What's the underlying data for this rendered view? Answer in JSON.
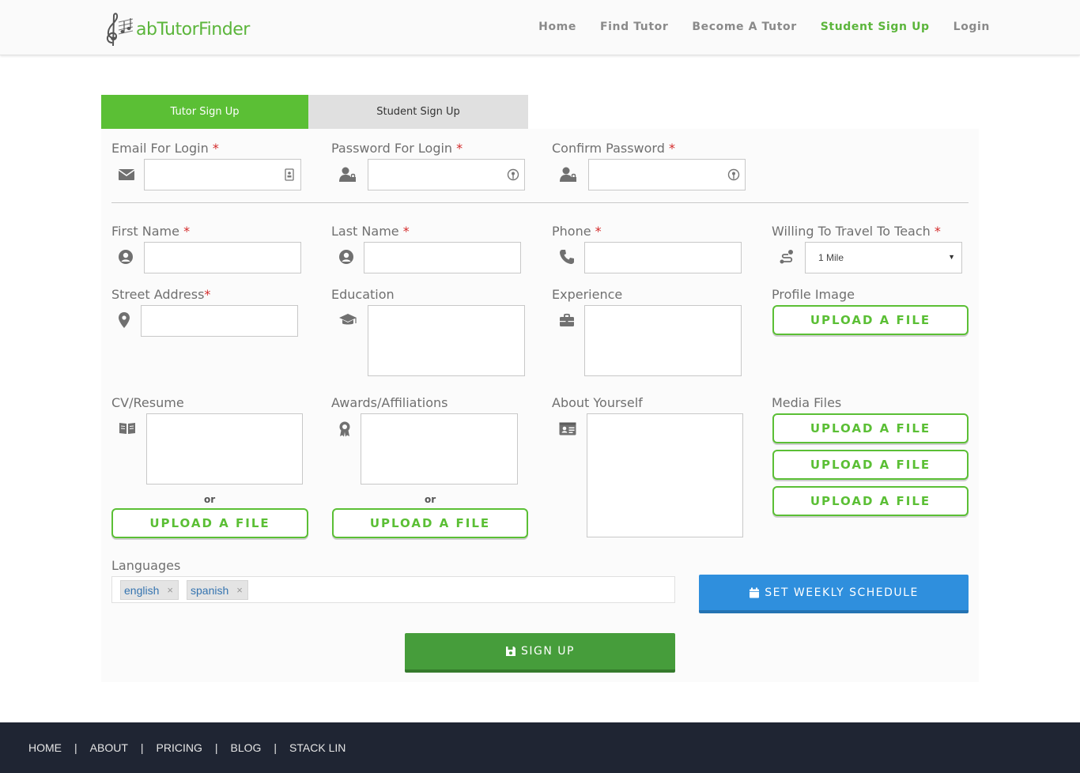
{
  "header": {
    "logo_text": "abTutorFinder",
    "nav": [
      "Home",
      "Find Tutor",
      "Become A Tutor",
      "Student Sign Up",
      "Login"
    ],
    "active_nav": "Student Sign Up"
  },
  "tabs": {
    "tutor": "Tutor Sign Up",
    "student": "Student Sign Up"
  },
  "form": {
    "email_label": "Email For Login",
    "password_label": "Password For Login",
    "confirm_label": "Confirm Password",
    "first_name_label": "First Name",
    "last_name_label": "Last Name",
    "phone_label": "Phone",
    "travel_label": "Willing To Travel To Teach",
    "travel_value": "1 Mile",
    "street_label": "Street Address",
    "education_label": "Education",
    "experience_label": "Experience",
    "profile_image_label": "Profile Image",
    "cv_label": "CV/Resume",
    "awards_label": "Awards/Affiliations",
    "about_label": "About Yourself",
    "media_label": "Media Files",
    "or_text": "or",
    "upload_label": "UPLOAD A FILE",
    "required_mark": "*",
    "languages_label": "Languages",
    "languages": [
      "english",
      "spanish"
    ],
    "tag_remove": "×",
    "schedule_button": "SET WEEKLY SCHEDULE",
    "signup_button": "SIGN UP"
  },
  "footer": {
    "links": [
      "HOME",
      "ABOUT",
      "PRICING",
      "BLOG",
      "STACK LIN"
    ],
    "separator": "|"
  },
  "colors": {
    "brand_green": "#5bbf35",
    "signup_green": "#469d3b",
    "schedule_blue": "#2f8fdd",
    "required_red": "#d42b2b",
    "footer_bg": "#1f2533"
  },
  "icons": [
    "envelope-icon",
    "user-lock-icon",
    "user-circle-icon",
    "phone-icon",
    "route-icon",
    "map-marker-icon",
    "graduation-cap-icon",
    "briefcase-icon",
    "book-open-icon",
    "award-icon",
    "id-card-icon",
    "calendar-icon",
    "save-icon",
    "contact-card-icon",
    "key-circle-icon",
    "treble-clef-icon"
  ]
}
